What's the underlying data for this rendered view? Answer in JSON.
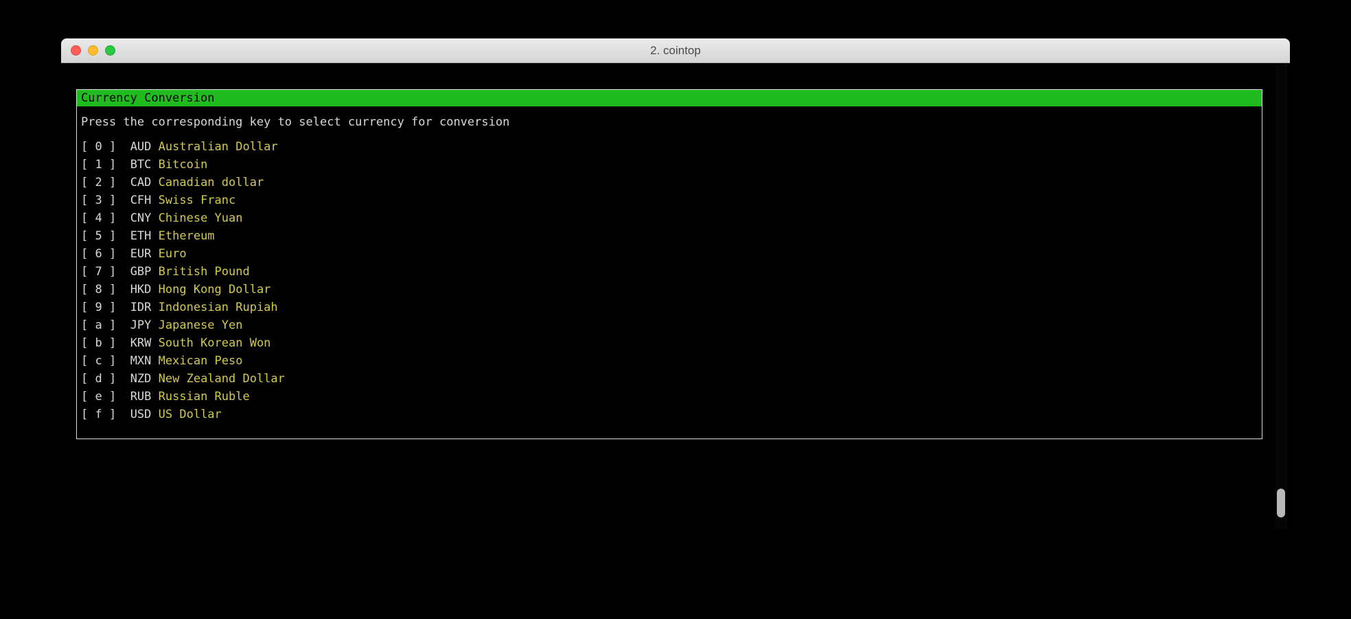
{
  "window": {
    "title": "2. cointop"
  },
  "panel": {
    "header": "Currency Conversion",
    "instruction": "Press the corresponding key to select currency for conversion"
  },
  "currencies": [
    {
      "key": "0",
      "code": "AUD",
      "name": "Australian Dollar"
    },
    {
      "key": "1",
      "code": "BTC",
      "name": "Bitcoin"
    },
    {
      "key": "2",
      "code": "CAD",
      "name": "Canadian dollar"
    },
    {
      "key": "3",
      "code": "CFH",
      "name": "Swiss Franc"
    },
    {
      "key": "4",
      "code": "CNY",
      "name": "Chinese Yuan"
    },
    {
      "key": "5",
      "code": "ETH",
      "name": "Ethereum"
    },
    {
      "key": "6",
      "code": "EUR",
      "name": "Euro"
    },
    {
      "key": "7",
      "code": "GBP",
      "name": "British Pound"
    },
    {
      "key": "8",
      "code": "HKD",
      "name": "Hong Kong Dollar"
    },
    {
      "key": "9",
      "code": "IDR",
      "name": "Indonesian Rupiah"
    },
    {
      "key": "a",
      "code": "JPY",
      "name": "Japanese Yen"
    },
    {
      "key": "b",
      "code": "KRW",
      "name": "South Korean Won"
    },
    {
      "key": "c",
      "code": "MXN",
      "name": "Mexican Peso"
    },
    {
      "key": "d",
      "code": "NZD",
      "name": "New Zealand Dollar"
    },
    {
      "key": "e",
      "code": "RUB",
      "name": "Russian Ruble"
    },
    {
      "key": "f",
      "code": "USD",
      "name": "US Dollar"
    }
  ]
}
